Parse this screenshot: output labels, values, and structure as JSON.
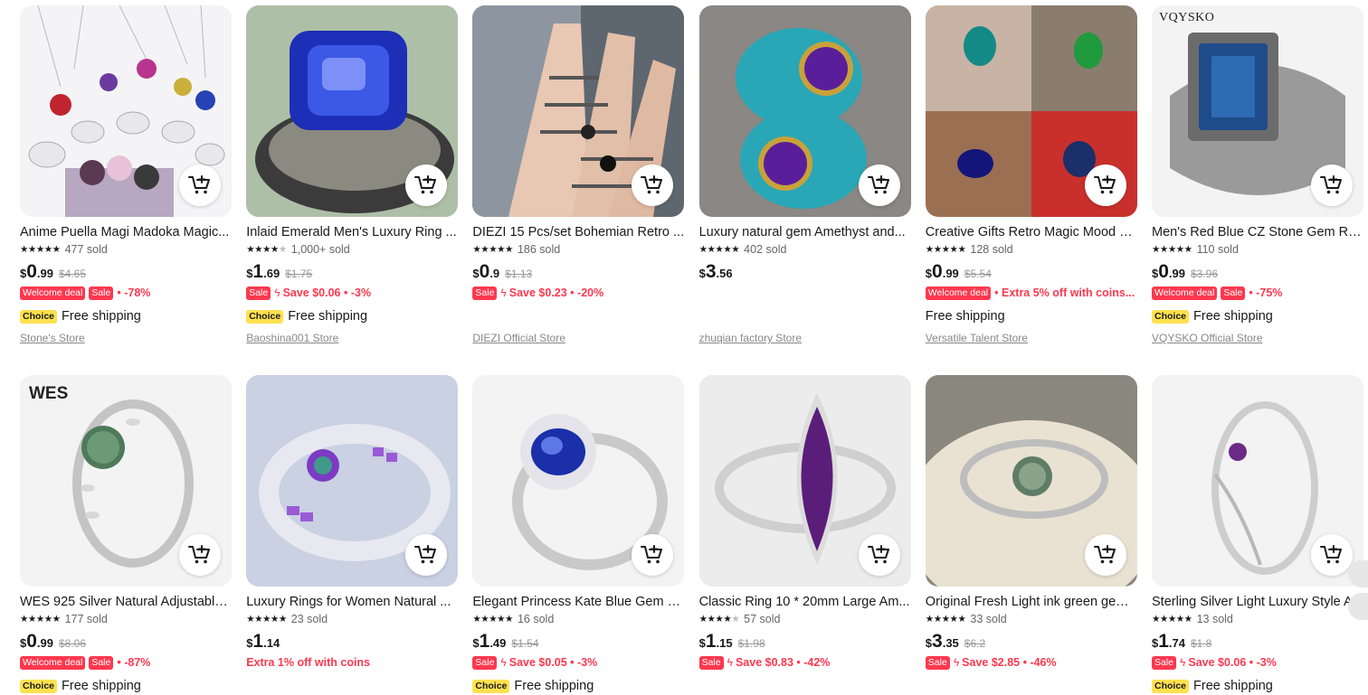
{
  "products": [
    {
      "title": "Anime Puella Magi Madoka Magic...",
      "sold": "477 sold",
      "rating": 5,
      "price_cur": "$",
      "price_main": "0",
      "price_cents": ".99",
      "orig": "$4.65",
      "tags": [
        "Welcome deal",
        "Sale"
      ],
      "promo": "• -78%",
      "choice": true,
      "shipping": "Free shipping",
      "store": "Stone's Store"
    },
    {
      "title": "Inlaid Emerald Men's Luxury Ring ...",
      "sold": "1,000+ sold",
      "rating": 4,
      "price_cur": "$",
      "price_main": "1",
      "price_cents": ".69",
      "orig": "$1.75",
      "tags": [
        "Sale"
      ],
      "bolt": true,
      "promo": "Save $0.06 • -3%",
      "choice": true,
      "shipping": "Free shipping",
      "store": "Baoshina001 Store"
    },
    {
      "title": "DIEZI 15 Pcs/set Bohemian Retro ...",
      "sold": "186 sold",
      "rating": 4.5,
      "price_cur": "$",
      "price_main": "0",
      "price_cents": ".9",
      "orig": "$1.13",
      "tags": [
        "Sale"
      ],
      "bolt": true,
      "promo": "Save $0.23 • -20%",
      "choice": false,
      "shipping": "",
      "store": "DIEZI Official Store"
    },
    {
      "title": "Luxury natural gem Amethyst and...",
      "sold": "402 sold",
      "rating": 4.5,
      "price_cur": "$",
      "price_main": "3",
      "price_cents": ".56",
      "orig": "",
      "tags": [],
      "promo": "",
      "choice": false,
      "shipping": "",
      "store": "zhuqian factory Store"
    },
    {
      "title": "Creative Gifts Retro Magic Mood R...",
      "sold": "128 sold",
      "rating": 4.5,
      "price_cur": "$",
      "price_main": "0",
      "price_cents": ".99",
      "orig": "$5.54",
      "tags": [
        "Welcome deal"
      ],
      "promo": "• Extra 5% off with coins...",
      "choice": false,
      "shipping": "Free shipping",
      "store": "Versatile Talent Store"
    },
    {
      "title": "Men's Red Blue CZ Stone Gem Rin...",
      "sold": "110 sold",
      "rating": 4.5,
      "price_cur": "$",
      "price_main": "0",
      "price_cents": ".99",
      "orig": "$3.96",
      "tags": [
        "Welcome deal",
        "Sale"
      ],
      "promo": "• -75%",
      "choice": true,
      "shipping": "Free shipping",
      "store": "VQYSKO Official Store",
      "brand": "VQYSKO"
    },
    {
      "title": "WES 925 Silver Natural Adjustable...",
      "sold": "177 sold",
      "rating": 5,
      "price_cur": "$",
      "price_main": "0",
      "price_cents": ".99",
      "orig": "$8.06",
      "tags": [
        "Welcome deal",
        "Sale"
      ],
      "promo": "• -87%",
      "choice": true,
      "shipping": "Free shipping",
      "store": "",
      "brand": "WES"
    },
    {
      "title": "Luxury Rings for Women Natural ...",
      "sold": "23 sold",
      "rating": 5,
      "price_cur": "$",
      "price_main": "1",
      "price_cents": ".14",
      "orig": "",
      "tags": [],
      "promo": "Extra 1% off with coins",
      "choice": false,
      "shipping": "",
      "store": ""
    },
    {
      "title": "Elegant Princess Kate Blue Gem Cr...",
      "sold": "16 sold",
      "rating": 5,
      "price_cur": "$",
      "price_main": "1",
      "price_cents": ".49",
      "orig": "$1.54",
      "tags": [
        "Sale"
      ],
      "bolt": true,
      "promo": "Save $0.05 • -3%",
      "choice": true,
      "shipping": "Free shipping",
      "store": ""
    },
    {
      "title": "Classic Ring 10 * 20mm Large Am...",
      "sold": "57 sold",
      "rating": 4,
      "price_cur": "$",
      "price_main": "1",
      "price_cents": ".15",
      "orig": "$1.98",
      "tags": [
        "Sale"
      ],
      "bolt": true,
      "promo": "Save $0.83 • -42%",
      "choice": false,
      "shipping": "",
      "store": ""
    },
    {
      "title": "Original Fresh Light ink green gem...",
      "sold": "33 sold",
      "rating": 5,
      "price_cur": "$",
      "price_main": "3",
      "price_cents": ".35",
      "orig": "$6.2",
      "tags": [
        "Sale"
      ],
      "bolt": true,
      "promo": "Save $2.85 • -46%",
      "choice": false,
      "shipping": "",
      "store": ""
    },
    {
      "title": "Sterling Silver Light Luxury Style A...",
      "sold": "13 sold",
      "rating": 5,
      "price_cur": "$",
      "price_main": "1",
      "price_cents": ".74",
      "orig": "$1.8",
      "tags": [
        "Sale"
      ],
      "bolt": true,
      "promo": "Save $0.06 • -3%",
      "choice": true,
      "shipping": "Free shipping",
      "store": ""
    }
  ],
  "labels": {
    "choice_badge": "Choice"
  },
  "colors": {
    "sale_red": "#fd384f",
    "choice_yellow": "#ffe14f"
  },
  "icons": {
    "cart": "add-to-cart-icon",
    "star": "star-icon"
  }
}
